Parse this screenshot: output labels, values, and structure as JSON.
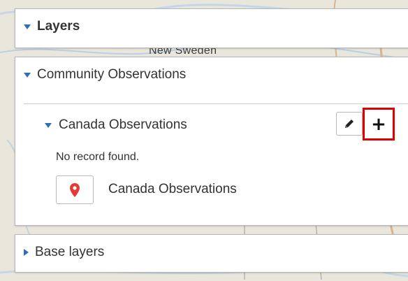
{
  "map": {
    "place_label": "New Sweden"
  },
  "layers_panel": {
    "title": "Layers"
  },
  "community_panel": {
    "title": "Community Observations",
    "group": {
      "title": "Canada Observations",
      "edit_icon": "pencil-icon",
      "add_icon": "plus-icon",
      "add_label": "+",
      "empty_message": "No record found.",
      "legend": {
        "icon": "map-marker-icon",
        "label": "Canada Observations",
        "marker_color": "#e53935"
      }
    }
  },
  "base_panel": {
    "title": "Base layers"
  },
  "colors": {
    "accent": "#2e6fb7",
    "highlight": "#e00000"
  }
}
